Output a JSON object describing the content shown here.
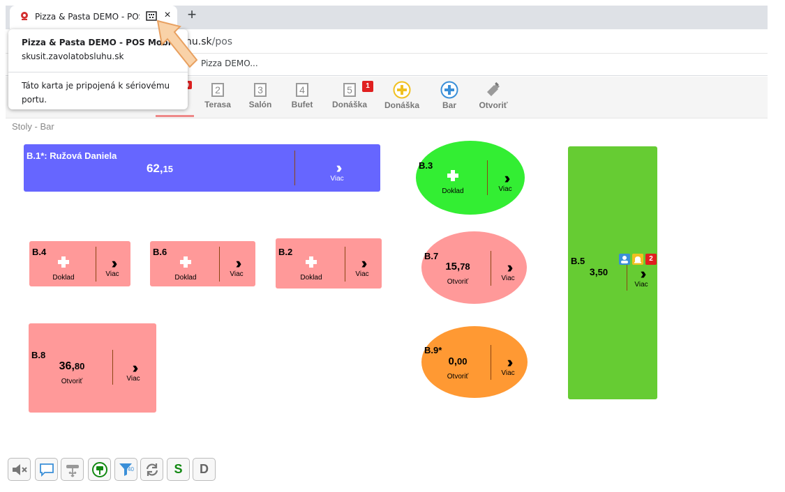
{
  "browser": {
    "tab_title": "Pizza & Pasta DEMO - POS M",
    "tab_close": "×",
    "new_tab": "+",
    "url_host": "skusit.zavolatobsluhu.sk",
    "url_visible_part": "hu.sk",
    "url_path": "/pos",
    "bookmark": "Pizza DEMO..."
  },
  "popup": {
    "title": "Pizza & Pasta DEMO - POS Mobile",
    "host": "skusit.zavolatobsluhu.sk",
    "message": "Táto karta je pripojená k sériovému portu."
  },
  "nav": {
    "items": [
      {
        "label": "Terasa",
        "num": "2"
      },
      {
        "label": "Salón",
        "num": "3"
      },
      {
        "label": "Bufet",
        "num": "4"
      },
      {
        "label": "Donáška",
        "num": "5",
        "badge": "1"
      },
      {
        "label": "Donáška",
        "icon": "plus-circle-yellow-icon"
      },
      {
        "label": "Bar",
        "icon": "plus-circle-blue-icon"
      },
      {
        "label": "Otvoriť",
        "icon": "bottle-icon"
      }
    ],
    "hidden_badge": "9"
  },
  "breadcrumb": "Stoly - Bar",
  "tables": {
    "b1": {
      "name": "B.1*: Ružová Daniela",
      "amount_main": "62,",
      "amount_cents": "15",
      "more": "Viac",
      "color": "#6666ff"
    },
    "b3": {
      "name": "B.3",
      "action": "Doklad",
      "more": "Viac",
      "color": "#33ee33"
    },
    "b4": {
      "name": "B.4",
      "action": "Doklad",
      "more": "Viac",
      "color": "#ff9999"
    },
    "b6": {
      "name": "B.6",
      "action": "Doklad",
      "more": "Viac",
      "color": "#ff9999"
    },
    "b2": {
      "name": "B.2",
      "action": "Doklad",
      "more": "Viac",
      "color": "#ff9999"
    },
    "b7": {
      "name": "B.7",
      "amount_main": "15,",
      "amount_cents": "78",
      "status": "Otvoriť",
      "more": "Viac",
      "color": "#ff9999"
    },
    "b5": {
      "name": "B.5",
      "amount_main": "3,",
      "amount_cents": "50",
      "more": "Viac",
      "badge": "2",
      "color": "#66cc33"
    },
    "b8": {
      "name": "B.8",
      "amount_main": "36,",
      "amount_cents": "80",
      "status": "Otvoriť",
      "more": "Viac",
      "color": "#ff9999"
    },
    "b9": {
      "name": "B.9*",
      "amount_main": "0,",
      "amount_cents": "00",
      "status": "Otvoriť",
      "more": "Viac",
      "color": "#ff9933"
    }
  },
  "toolbar": {
    "filter_badge": "40",
    "s_label": "S",
    "d_label": "D"
  }
}
